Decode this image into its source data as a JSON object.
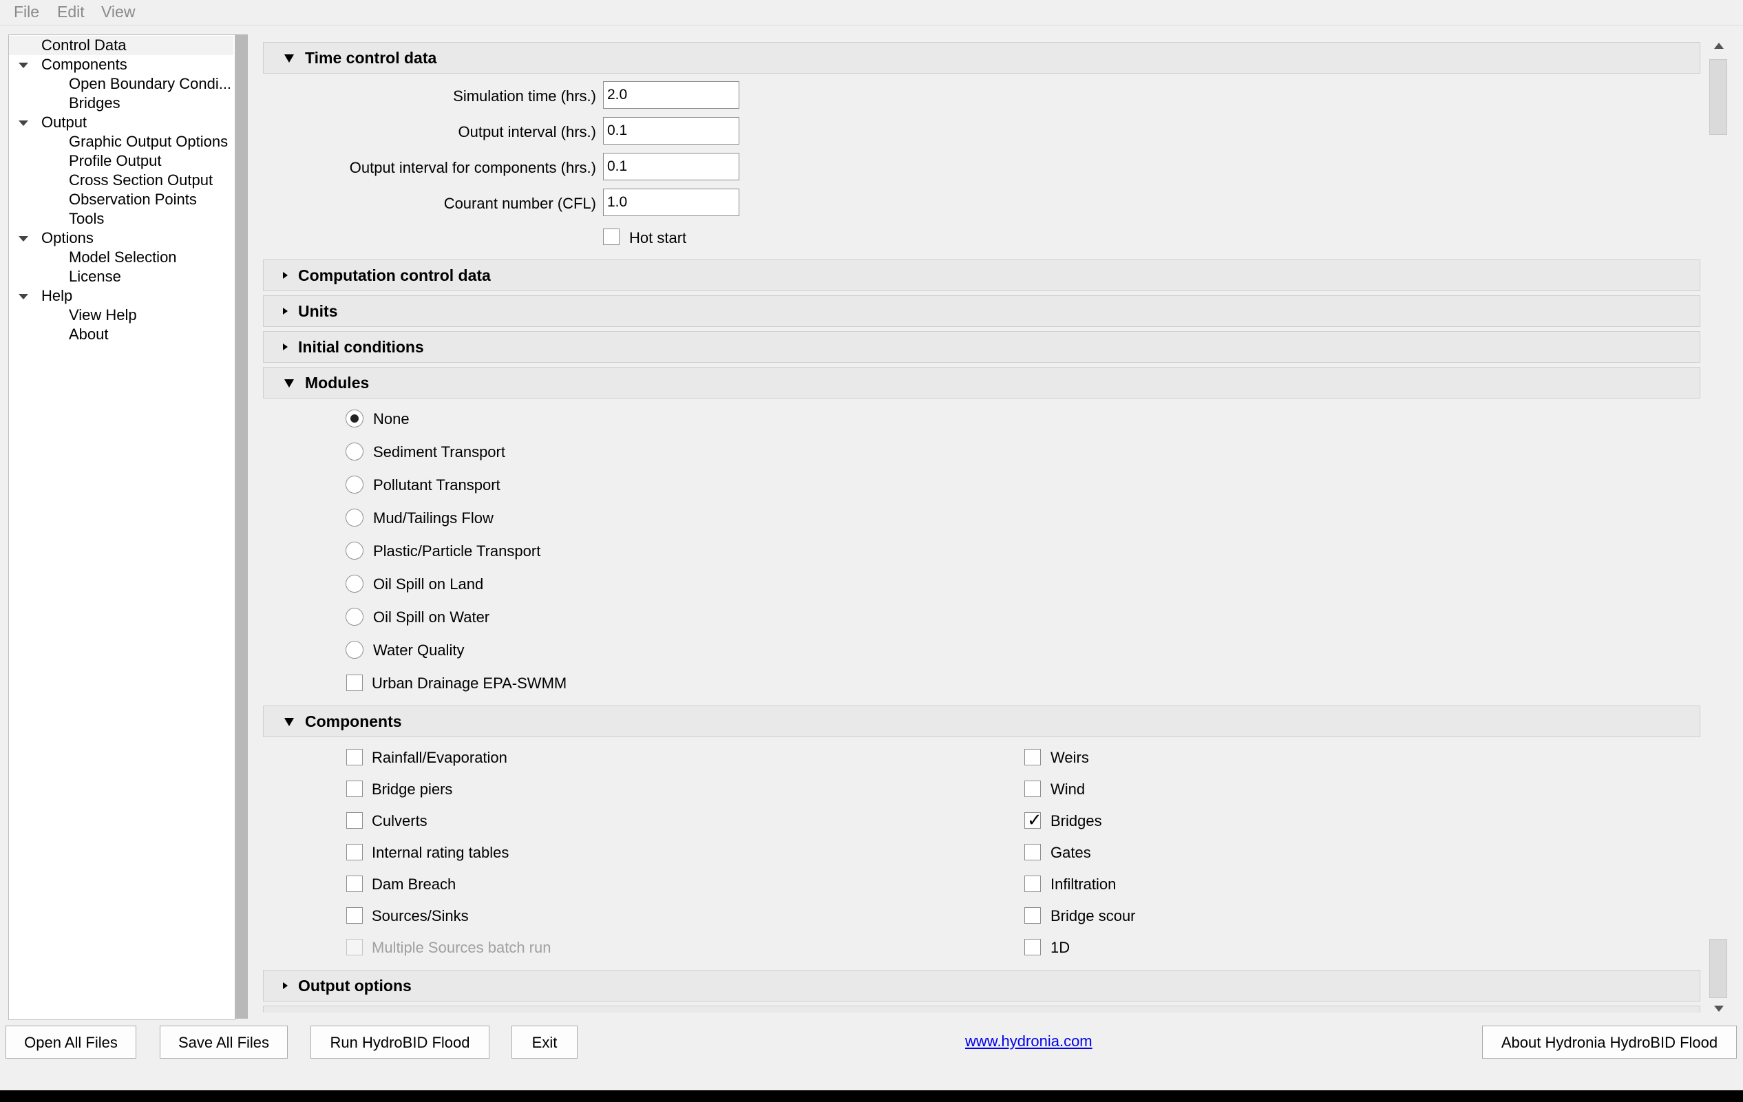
{
  "menubar": {
    "file": "File",
    "edit": "Edit",
    "view": "View"
  },
  "tree": {
    "control_data": "Control Data",
    "components": "Components",
    "open_boundary": "Open Boundary Condi...",
    "bridges": "Bridges",
    "output": "Output",
    "graphic_output": "Graphic Output Options",
    "profile_output": "Profile Output",
    "cross_section": "Cross Section Output",
    "observation_points": "Observation Points",
    "tools": "Tools",
    "options": "Options",
    "model_selection": "Model Selection",
    "license": "License",
    "help": "Help",
    "view_help": "View Help",
    "about": "About"
  },
  "time_control": {
    "title": "Time control data",
    "sim_time_label": "Simulation time (hrs.)",
    "sim_time_value": "2.0",
    "output_interval_label": "Output interval (hrs.)",
    "output_interval_value": "0.1",
    "output_interval_comp_label": "Output interval for components (hrs.)",
    "output_interval_comp_value": "0.1",
    "courant_label": "Courant number (CFL)",
    "courant_value": "1.0",
    "hot_start_label": "Hot start",
    "hot_start_checked": false
  },
  "sections": {
    "computation": "Computation control data",
    "units": "Units",
    "initial": "Initial conditions",
    "modules": "Modules",
    "components": "Components",
    "output_options": "Output options"
  },
  "modules": {
    "none": "None",
    "sediment": "Sediment Transport",
    "pollutant": "Pollutant Transport",
    "mud": "Mud/Tailings Flow",
    "plastic": "Plastic/Particle Transport",
    "oil_land": "Oil Spill on Land",
    "oil_water": "Oil Spill on Water",
    "water_quality": "Water Quality",
    "urban_drainage": "Urban Drainage EPA-SWMM",
    "selected": "None"
  },
  "components": {
    "rainfall": "Rainfall/Evaporation",
    "bridge_piers": "Bridge piers",
    "culverts": "Culverts",
    "internal_rating": "Internal rating tables",
    "dam_breach": "Dam Breach",
    "sources_sinks": "Sources/Sinks",
    "multiple_sources": "Multiple Sources batch run",
    "weirs": "Weirs",
    "wind": "Wind",
    "bridges": "Bridges",
    "gates": "Gates",
    "infiltration": "Infiltration",
    "bridge_scour": "Bridge scour",
    "one_d": "1D",
    "bridges_checked": true
  },
  "footer": {
    "open_all": "Open All Files",
    "save_all": "Save All Files",
    "run": "Run HydroBID Flood",
    "exit": "Exit",
    "link": "www.hydronia.com",
    "about": "About Hydronia HydroBID Flood"
  },
  "colors": {
    "link": "#0000ee",
    "header_bg": "#e9e9e9",
    "window_bg": "#f0f0f0"
  }
}
